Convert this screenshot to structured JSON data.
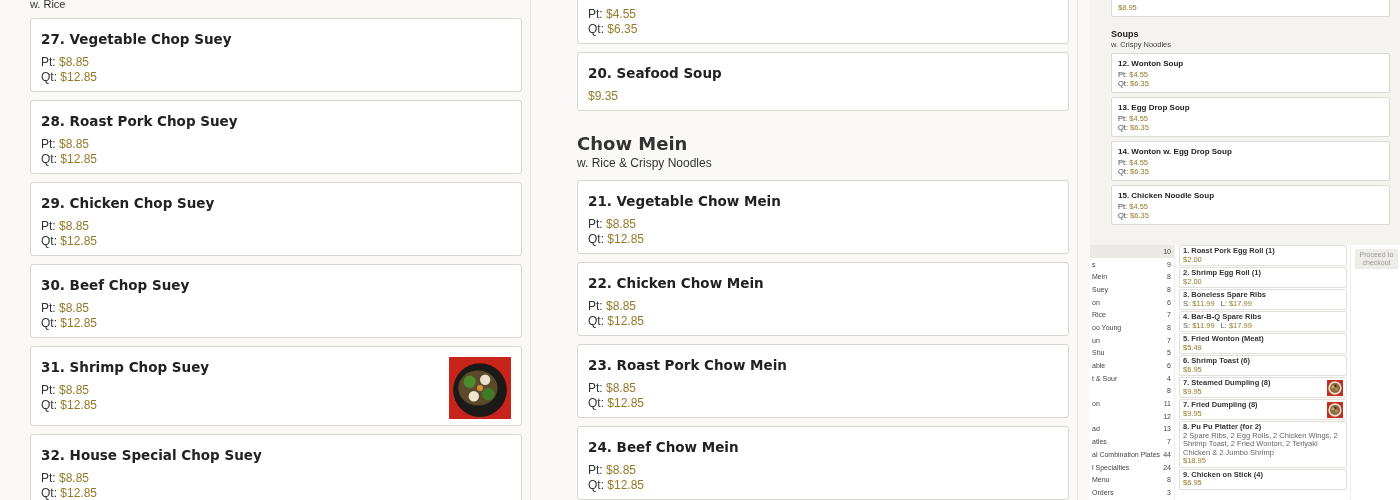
{
  "left": {
    "subtitle": "w. Rice",
    "items": [
      {
        "name": "27. Vegetable Chop Suey",
        "prices": [
          {
            "label": "Pt:",
            "value": "$8.85"
          },
          {
            "label": "Qt:",
            "value": "$12.85"
          }
        ]
      },
      {
        "name": "28. Roast Pork Chop Suey",
        "prices": [
          {
            "label": "Pt:",
            "value": "$8.85"
          },
          {
            "label": "Qt:",
            "value": "$12.85"
          }
        ]
      },
      {
        "name": "29. Chicken Chop Suey",
        "prices": [
          {
            "label": "Pt:",
            "value": "$8.85"
          },
          {
            "label": "Qt:",
            "value": "$12.85"
          }
        ]
      },
      {
        "name": "30. Beef Chop Suey",
        "prices": [
          {
            "label": "Pt:",
            "value": "$8.85"
          },
          {
            "label": "Qt:",
            "value": "$12.85"
          }
        ]
      },
      {
        "name": "31. Shrimp Chop Suey",
        "prices": [
          {
            "label": "Pt:",
            "value": "$8.85"
          },
          {
            "label": "Qt:",
            "value": "$12.85"
          }
        ],
        "kind": "picture"
      },
      {
        "name": "32. House Special Chop Suey",
        "prices": [
          {
            "label": "Pt:",
            "value": "$8.85"
          },
          {
            "label": "Qt:",
            "value": "$12.85"
          }
        ]
      }
    ]
  },
  "middle": {
    "top_card": {
      "prices": [
        {
          "label": "Pt:",
          "value": "$4.55"
        },
        {
          "label": "Qt:",
          "value": "$6.35"
        }
      ]
    },
    "items": [
      {
        "name": "20. Seafood Soup",
        "prices": [
          {
            "value": "$9.35"
          }
        ]
      }
    ],
    "section": {
      "title": "Chow Mein",
      "subtitle": "w. Rice & Crispy Noodles",
      "items": [
        {
          "name": "21. Vegetable Chow Mein",
          "prices": [
            {
              "label": "Pt:",
              "value": "$8.85"
            },
            {
              "label": "Qt:",
              "value": "$12.85"
            }
          ]
        },
        {
          "name": "22. Chicken Chow Mein",
          "prices": [
            {
              "label": "Pt:",
              "value": "$8.85"
            },
            {
              "label": "Qt:",
              "value": "$12.85"
            }
          ]
        },
        {
          "name": "23. Roast Pork Chow Mein",
          "prices": [
            {
              "label": "Pt:",
              "value": "$8.85"
            },
            {
              "label": "Qt:",
              "value": "$12.85"
            }
          ]
        },
        {
          "name": "24. Beef Chow Mein",
          "prices": [
            {
              "label": "Pt:",
              "value": "$8.85"
            },
            {
              "label": "Qt:",
              "value": "$12.85"
            }
          ]
        }
      ]
    }
  },
  "inset_top": {
    "top_card": {
      "prices": [
        {
          "value": "$8.95"
        }
      ]
    },
    "title": "Soups",
    "subtitle": "w. Crispy Noodles",
    "items": [
      {
        "name": "12. Wonton Soup",
        "prices": [
          {
            "label": "Pt:",
            "value": "$4.55"
          },
          {
            "label": "Qt:",
            "value": "$6.35"
          }
        ]
      },
      {
        "name": "13. Egg Drop Soup",
        "prices": [
          {
            "label": "Pt:",
            "value": "$4.55"
          },
          {
            "label": "Qt:",
            "value": "$6.35"
          }
        ]
      },
      {
        "name": "14. Wonton w. Egg Drop Soup",
        "prices": [
          {
            "label": "Pt:",
            "value": "$4.55"
          },
          {
            "label": "Qt:",
            "value": "$6.35"
          }
        ]
      },
      {
        "name": "15. Chicken Noodle Soup",
        "prices": [
          {
            "label": "Pt:",
            "value": "$4.55"
          },
          {
            "label": "Qt:",
            "value": "$6.35"
          }
        ]
      }
    ]
  },
  "inset_bottom": {
    "sidebar": [
      {
        "count": "10",
        "selected": true
      },
      {
        "label": "s",
        "count": "9",
        "selected": false
      },
      {
        "label": "Mein",
        "count": "8",
        "selected": false
      },
      {
        "label": "Suey",
        "count": "8",
        "selected": false
      },
      {
        "label": "on",
        "count": "6",
        "selected": false
      },
      {
        "label": "Rice",
        "count": "7",
        "selected": false
      },
      {
        "label": "oo Young",
        "count": "8",
        "selected": false
      },
      {
        "label": "un",
        "count": "7",
        "selected": false
      },
      {
        "label": "Shu",
        "count": "5",
        "selected": false
      },
      {
        "label": "able",
        "count": "6",
        "selected": false
      },
      {
        "label": "t & Sour",
        "count": "4",
        "selected": false
      },
      {
        "count": "8",
        "selected": false
      },
      {
        "label": "on",
        "count": "11",
        "selected": false
      },
      {
        "count": "12",
        "selected": false
      },
      {
        "label": "ad",
        "count": "13",
        "selected": false
      },
      {
        "label": "atles",
        "count": "7",
        "selected": false
      },
      {
        "label": "al Combination Plates",
        "count": "44",
        "selected": false
      },
      {
        "label": "l Specialties",
        "count": "24",
        "selected": false
      },
      {
        "label": "Menu",
        "count": "8",
        "selected": false
      },
      {
        "label": "Orders",
        "count": "3",
        "selected": false
      }
    ],
    "items": [
      {
        "name": "1. Roast Pork Egg Roll (1)",
        "prices": [
          {
            "value": "$2.00"
          }
        ]
      },
      {
        "name": "2. Shrimp Egg Roll (1)",
        "prices": [
          {
            "value": "$2.00"
          }
        ]
      },
      {
        "name": "3. Boneless Spare Ribs",
        "prices": [
          {
            "label": "S:",
            "value": "$11.99"
          },
          {
            "label": "L:",
            "value": "$17.99"
          }
        ]
      },
      {
        "name": "4. Bar-B-Q Spare Ribs",
        "prices": [
          {
            "label": "S:",
            "value": "$11.99"
          },
          {
            "label": "L:",
            "value": "$17.99"
          }
        ]
      },
      {
        "name": "5. Fried Wonton (Meat)",
        "prices": [
          {
            "value": "$5.49"
          }
        ]
      },
      {
        "name": "6. Shrimp Toast (6)",
        "prices": [
          {
            "value": "$6.95"
          }
        ]
      },
      {
        "name": "7. Steamed Dumpling (8)",
        "prices": [
          {
            "value": "$9.95"
          }
        ],
        "kind": "picture"
      },
      {
        "name": "7. Fried Dumpling (8)",
        "prices": [
          {
            "value": "$9.95"
          }
        ],
        "kind": "picture"
      },
      {
        "name": "8. Pu Pu Platter (for 2)",
        "description": "2 Spare Ribs, 2 Egg Rolls, 2 Chicken Wings, 2 Shrimp Toast, 2 Fried Wonton, 2 Teriyaki Chicken & 2 Jumbo Shrimp",
        "prices": [
          {
            "value": "$18.95"
          }
        ]
      },
      {
        "name": "9. Chicken on Stick (4)",
        "prices": [
          {
            "value": "$6.95"
          }
        ]
      }
    ],
    "checkout": "Proceed to checkout"
  }
}
